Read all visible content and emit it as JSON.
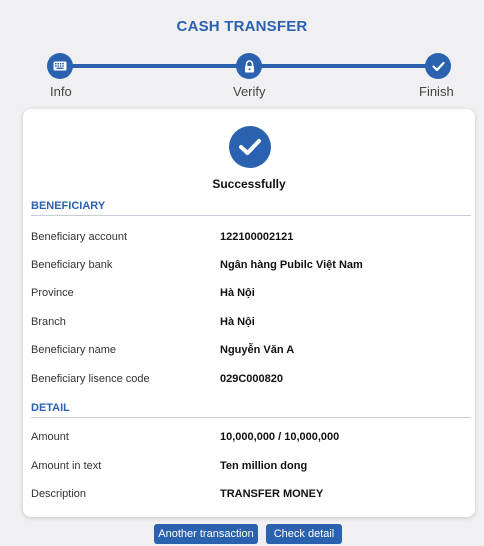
{
  "header": {
    "title": "CASH TRANSFER"
  },
  "stepper": {
    "steps": [
      {
        "label": "Info",
        "icon": "keyboard-icon"
      },
      {
        "label": "Verify",
        "icon": "lock-icon"
      },
      {
        "label": "Finish",
        "icon": "check-icon"
      }
    ],
    "accent_color": "#2b62b0"
  },
  "result": {
    "status_text": "Successfully",
    "icon": "check-circle-icon"
  },
  "beneficiary": {
    "heading": "BENEFICIARY",
    "rows": [
      {
        "label": "Beneficiary account",
        "value": "122100002121"
      },
      {
        "label": "Beneficiary bank",
        "value": "Ngân hàng Pubilc Việt Nam"
      },
      {
        "label": "Province",
        "value": "Hà Nội"
      },
      {
        "label": "Branch",
        "value": "Hà Nội"
      },
      {
        "label": "Beneficiary name",
        "value": "Nguyễn Văn A"
      },
      {
        "label": "Beneficiary lisence code",
        "value": "029C000820"
      }
    ]
  },
  "detail": {
    "heading": "DETAIL",
    "rows": [
      {
        "label": "Amount",
        "value": "10,000,000 / 10,000,000"
      },
      {
        "label": "Amount in text",
        "value": "Ten million  dong"
      },
      {
        "label": "Description",
        "value": "TRANSFER MONEY"
      }
    ]
  },
  "actions": {
    "another_label": "Another transaction",
    "check_label": "Check detail"
  }
}
